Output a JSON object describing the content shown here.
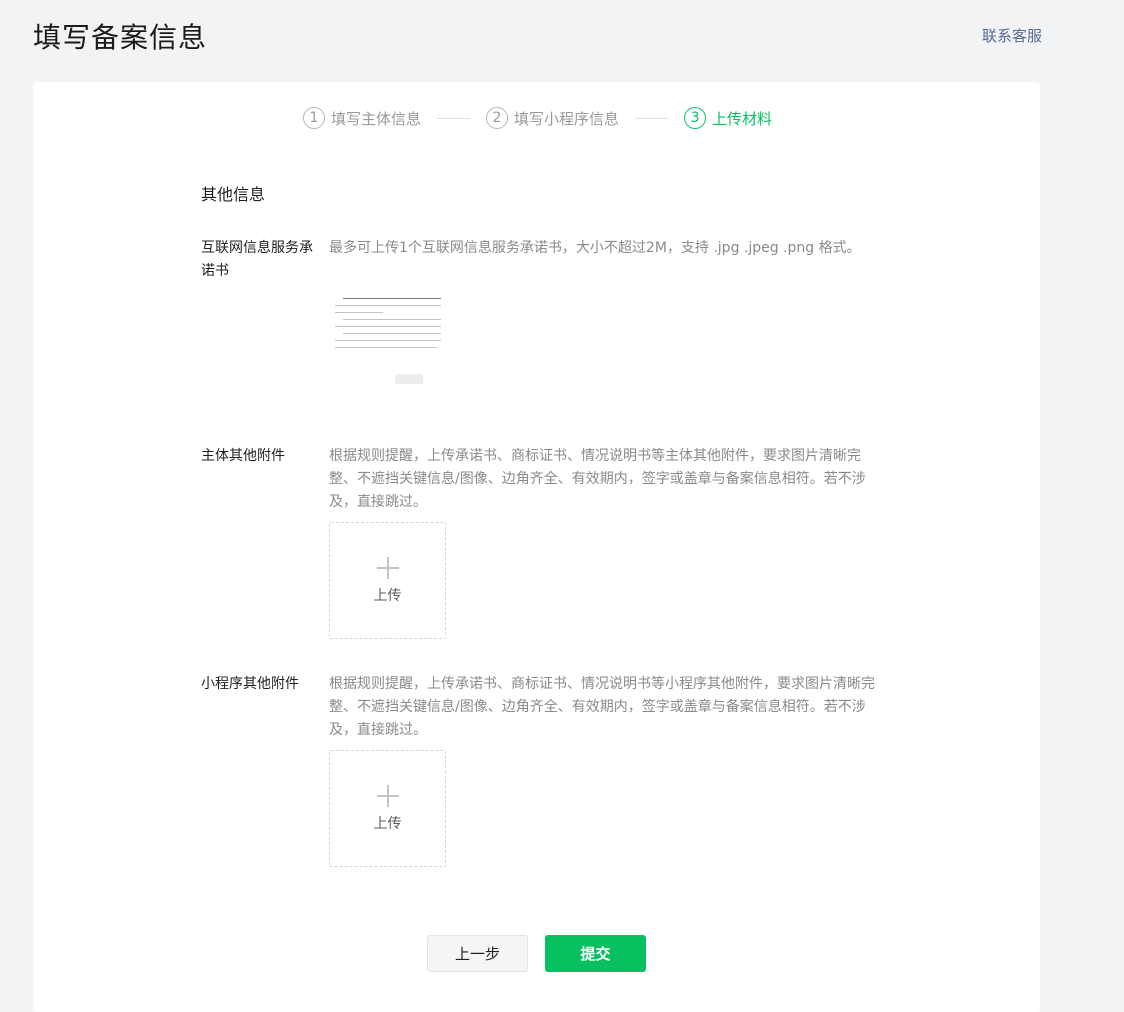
{
  "header": {
    "title": "填写备案信息",
    "contact": "联系客服"
  },
  "steps": [
    {
      "num": "1",
      "label": "填写主体信息",
      "active": false
    },
    {
      "num": "2",
      "label": "填写小程序信息",
      "active": false
    },
    {
      "num": "3",
      "label": "上传材料",
      "active": true
    }
  ],
  "colors": {
    "accent": "#07c160",
    "link": "#576b95"
  },
  "section": {
    "title": "其他信息"
  },
  "fields": {
    "commitment": {
      "label": "互联网信息服务承诺书",
      "desc": "最多可上传1个互联网信息服务承诺书，大小不超过2M，支持 .jpg .jpeg .png 格式。"
    },
    "entity_attachments": {
      "label": "主体其他附件",
      "desc": "根据规则提醒，上传承诺书、商标证书、情况说明书等主体其他附件，要求图片清晰完整、不遮挡关键信息/图像、边角齐全、有效期内，签字或盖章与备案信息相符。若不涉及，直接跳过。",
      "upload_label": "上传"
    },
    "miniprogram_attachments": {
      "label": "小程序其他附件",
      "desc": "根据规则提醒，上传承诺书、商标证书、情况说明书等小程序其他附件，要求图片清晰完整、不遮挡关键信息/图像、边角齐全、有效期内，签字或盖章与备案信息相符。若不涉及，直接跳过。",
      "upload_label": "上传"
    }
  },
  "actions": {
    "prev": "上一步",
    "submit": "提交"
  }
}
